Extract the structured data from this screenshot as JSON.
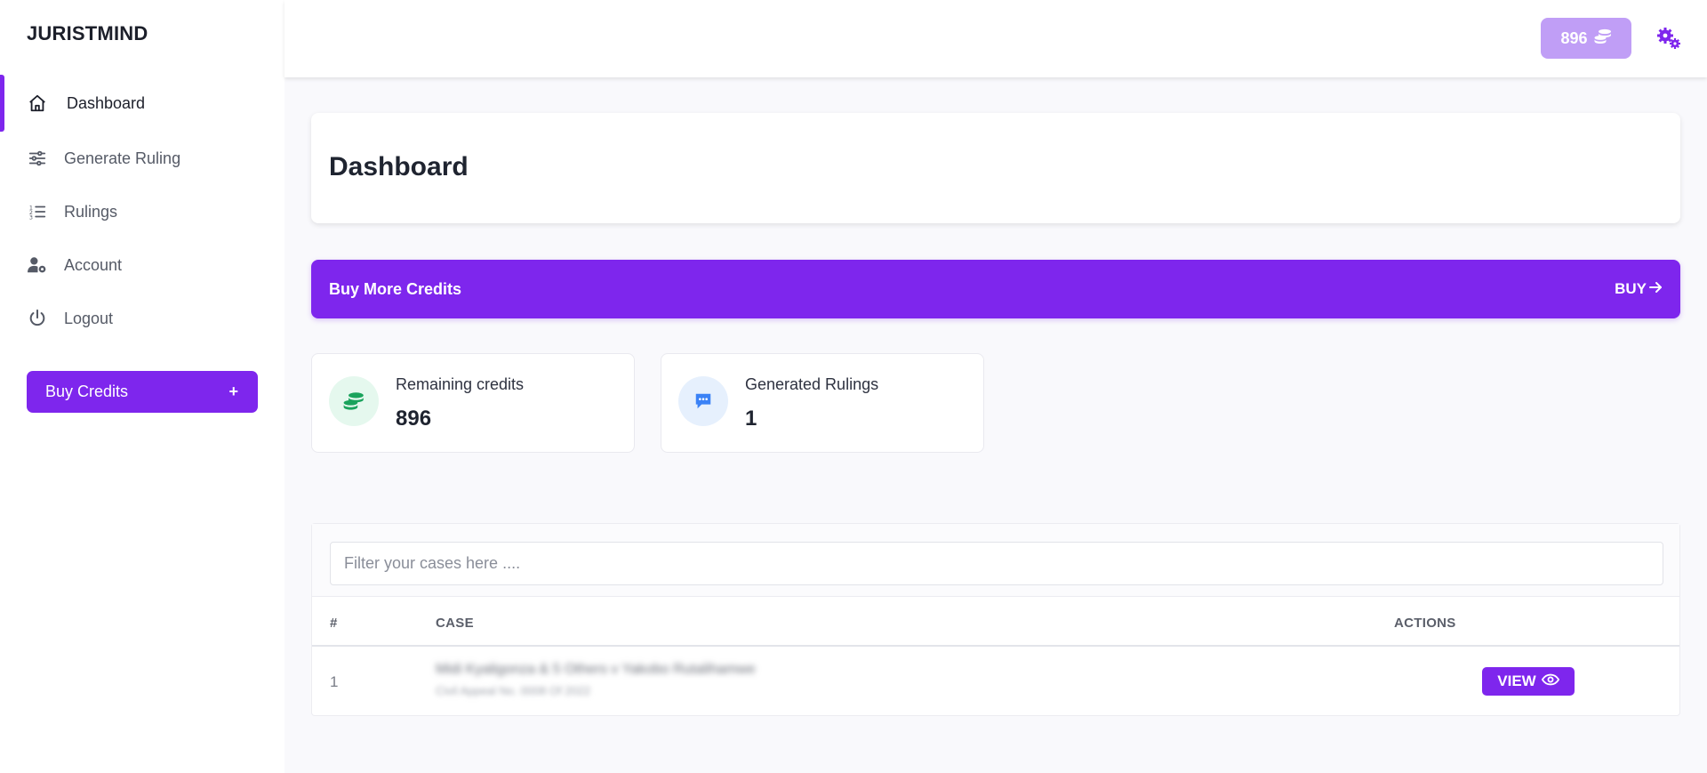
{
  "brand": "JURISTMIND",
  "sidebar": {
    "items": [
      {
        "label": "Dashboard",
        "icon": "home-icon"
      },
      {
        "label": "Generate Ruling",
        "icon": "sliders-icon"
      },
      {
        "label": "Rulings",
        "icon": "list-numbered-icon"
      },
      {
        "label": "Account",
        "icon": "user-gear-icon"
      },
      {
        "label": "Logout",
        "icon": "power-icon"
      }
    ],
    "buy_credits_label": "Buy Credits",
    "buy_credits_plus": "+"
  },
  "topbar": {
    "credits": "896",
    "credits_icon": "coins-icon",
    "settings_icon": "gears-icon"
  },
  "main": {
    "page_title": "Dashboard",
    "banner": {
      "text": "Buy More Credits",
      "action_label": "BUY",
      "action_icon": "arrow-right-icon"
    },
    "stats": [
      {
        "label": "Remaining credits",
        "value": "896",
        "icon": "coins-icon"
      },
      {
        "label": "Generated Rulings",
        "value": "1",
        "icon": "chat-icon"
      }
    ],
    "table": {
      "filter_placeholder": "Filter your cases here ....",
      "columns": [
        "#",
        "CASE",
        "ACTIONS"
      ],
      "rows": [
        {
          "num": "1",
          "case_title": "Midi Kyaligonza & 5 Others v Yakobo Rutalihamwe",
          "case_sub": "Civil Appeal No. 0008 Of 2022",
          "action": "VIEW"
        }
      ]
    }
  },
  "colors": {
    "accent": "#7e26ed",
    "accent_light": "#c09ef6",
    "stat_green_bg": "#e5f8ee",
    "stat_green": "#1aa35c",
    "stat_blue_bg": "#e6f0fd",
    "stat_blue": "#3b82f6"
  }
}
